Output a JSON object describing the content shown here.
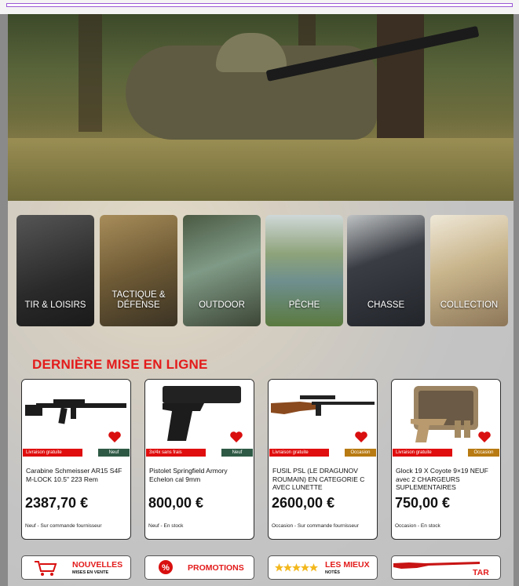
{
  "categories": [
    {
      "label": "TIR & LOISIRS"
    },
    {
      "label": "TACTIQUE & DÉFENSE"
    },
    {
      "label": "OUTDOOR"
    },
    {
      "label": "PÊCHE"
    },
    {
      "label": "CHASSE"
    },
    {
      "label": "COLLECTION"
    }
  ],
  "section_title": "DERNIÈRE MISE EN LIGNE",
  "products": [
    {
      "tag_left": "Livraison gratuite",
      "tag_right": "Neuf",
      "tag_right_color": "#2e5a45",
      "name": "Carabine Schmeisser AR15 S4F M-LOCK 10.5\" 223 Rem",
      "price": "2387,70 €",
      "status": "Neuf - Sur commande fournisseur"
    },
    {
      "tag_left": "3x/4x sans frais",
      "tag_right": "Neuf",
      "tag_right_color": "#2e5a45",
      "name": "Pistolet Springfield Armory Echelon cal 9mm",
      "price": "800,00 €",
      "status": "Neuf - En stock"
    },
    {
      "tag_left": "Livraison gratuite",
      "tag_right": "Occasion",
      "tag_right_color": "#b87a12",
      "name": "FUSIL PSL (LE DRAGUNOV ROUMAIN) EN CATEGORIE C AVEC LUNETTE",
      "price": "2600,00 €",
      "status": "Occasion - Sur commande fournisseur"
    },
    {
      "tag_left": "Livraison gratuite",
      "tag_right": "Occasion",
      "tag_right_color": "#b87a12",
      "name": "Glock 19 X Coyote 9×19 NEUF avec 2 CHARGEURS SUPLEMENTAIRES",
      "price": "750,00 €",
      "status": "Occasion - En stock"
    }
  ],
  "buttons": [
    {
      "title": "NOUVELLES",
      "subtitle": "MISES EN VENTE",
      "icon": "cart-icon"
    },
    {
      "title": "PROMOTIONS",
      "subtitle": "",
      "icon": "percent-badge-icon"
    },
    {
      "title": "LES MIEUX",
      "subtitle": "NOTÉS",
      "icon": "stars-icon"
    },
    {
      "title": "TAR",
      "subtitle": "",
      "icon": "rifle-icon"
    }
  ],
  "colors": {
    "accent": "#e31b1b",
    "new": "#2e5a45",
    "used": "#b87a12"
  }
}
